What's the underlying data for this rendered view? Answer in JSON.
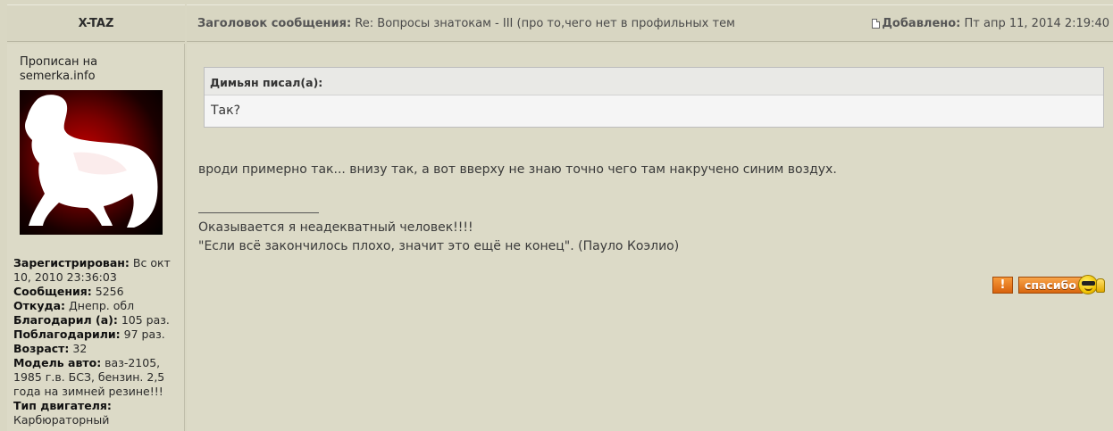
{
  "post": {
    "author": "X-TAZ",
    "subject_label": "Заголовок сообщения:",
    "subject": "Re: Вопросы знатокам - III (про то,чего нет в профильных тем",
    "date_label": "Добавлено:",
    "date": "Пт апр 11, 2014 2:19:40"
  },
  "user": {
    "registered_on": "Прописан на semerka.info",
    "profile": [
      {
        "label": "Зарегистрирован:",
        "value": "Вс окт 10, 2010 23:36:03"
      },
      {
        "label": "Сообщения:",
        "value": "5256"
      },
      {
        "label": "Откуда:",
        "value": "Днепр. обл"
      },
      {
        "label": "Благодарил (а):",
        "value": "105 раз."
      },
      {
        "label": "Поблагодарили:",
        "value": "97 раз."
      },
      {
        "label": "Возраст:",
        "value": "32"
      },
      {
        "label": "Модель авто:",
        "value": "ваз-2105, 1985 г.в. БСЗ, бензин. 2,5 года на зимней резине!!!"
      },
      {
        "label": "Тип двигателя:",
        "value": "Карбюраторный"
      }
    ]
  },
  "quote": {
    "author": "Димьян писал(а):",
    "text": "Так?"
  },
  "message": "вроди примерно так... внизу так, а вот вверху не знаю точно чего там накручено синим воздух.",
  "signature": {
    "line1": "Оказывается я неадекватный человек!!!!",
    "line2": "\"Если всё закончилось плохо, значит это ещё не конец\". (Пауло Коэлио)"
  },
  "buttons": {
    "report": "!",
    "thanks": "спасибо"
  },
  "icons": {
    "post": "post-icon",
    "smiley": "smiley-thumbs-up-icon"
  }
}
